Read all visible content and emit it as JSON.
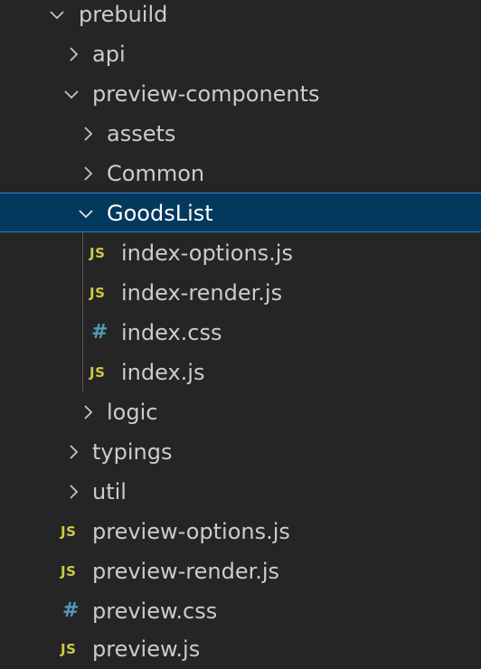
{
  "explorer": {
    "items": [
      {
        "label": "prebuild",
        "type": "folder",
        "expanded": true,
        "depth": 0
      },
      {
        "label": "api",
        "type": "folder",
        "expanded": false,
        "depth": 1
      },
      {
        "label": "preview-components",
        "type": "folder",
        "expanded": true,
        "depth": 1
      },
      {
        "label": "assets",
        "type": "folder",
        "expanded": false,
        "depth": 2
      },
      {
        "label": "Common",
        "type": "folder",
        "expanded": false,
        "depth": 2
      },
      {
        "label": "GoodsList",
        "type": "folder",
        "expanded": true,
        "depth": 2,
        "selected": true
      },
      {
        "label": "index-options.js",
        "type": "js",
        "depth": 3
      },
      {
        "label": "index-render.js",
        "type": "js",
        "depth": 3
      },
      {
        "label": "index.css",
        "type": "css",
        "depth": 3
      },
      {
        "label": "index.js",
        "type": "js",
        "depth": 3
      },
      {
        "label": "logic",
        "type": "folder",
        "expanded": false,
        "depth": 2
      },
      {
        "label": "typings",
        "type": "folder",
        "expanded": false,
        "depth": 1
      },
      {
        "label": "util",
        "type": "folder",
        "expanded": false,
        "depth": 1
      },
      {
        "label": "preview-options.js",
        "type": "js",
        "depth": 1
      },
      {
        "label": "preview-render.js",
        "type": "js",
        "depth": 1
      },
      {
        "label": "preview.css",
        "type": "css",
        "depth": 1
      },
      {
        "label": "preview.js",
        "type": "js",
        "depth": 1
      }
    ]
  },
  "icons": {
    "js_text": "JS",
    "css_text": "#"
  },
  "colors": {
    "background": "#252526",
    "selection": "#04395e",
    "selection_border": "#2f7fd8",
    "text": "#cccccc",
    "js_icon": "#cbcb41",
    "css_icon": "#519aba"
  }
}
